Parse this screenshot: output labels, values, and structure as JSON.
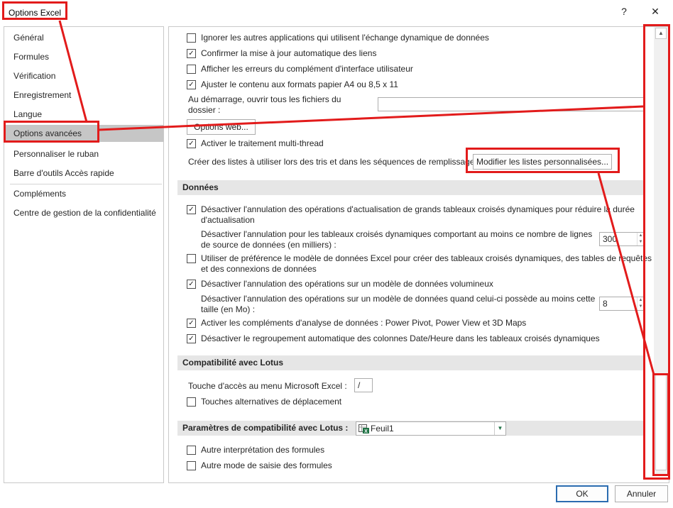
{
  "window": {
    "title": "Options Excel",
    "help_glyph": "?",
    "close_glyph": "✕"
  },
  "sidebar": {
    "items": [
      {
        "label": "Général"
      },
      {
        "label": "Formules"
      },
      {
        "label": "Vérification"
      },
      {
        "label": "Enregistrement"
      },
      {
        "label": "Langue"
      },
      {
        "label": "Options avancées",
        "selected": true
      },
      {
        "label": "Personnaliser le ruban"
      },
      {
        "label": "Barre d'outils Accès rapide"
      },
      {
        "label": "Compléments"
      },
      {
        "label": "Centre de gestion de la confidentialité"
      }
    ]
  },
  "general": {
    "opt_dde": {
      "label": "Ignorer les autres applications qui utilisent l'échange dynamique de données",
      "checked": false
    },
    "opt_links": {
      "label": "Confirmer la mise à jour automatique des liens",
      "checked": true
    },
    "opt_addin_errors": {
      "label": "Afficher les erreurs du complément d'interface utilisateur",
      "checked": false
    },
    "opt_paper": {
      "label": "Ajuster le contenu aux formats papier A4 ou 8,5 x 11",
      "checked": true
    },
    "startup_label_1": "Au démarrage, ouvrir tous les fichiers du",
    "startup_label_2": "dossier :",
    "startup_value": "",
    "web_options_button": "Options web...",
    "opt_multithread": {
      "label": "Activer le traitement multi-thread",
      "checked": true
    },
    "custom_lists_label": "Créer des listes à utiliser lors des tris et dans les séquences de remplissage :",
    "custom_lists_button": "Modifier les listes personnalisées..."
  },
  "data": {
    "section_title": "Données",
    "opt_pivot_undo": {
      "label_1": "Désactiver l'annulation des opérations d'actualisation de grands tableaux croisés dynamiques pour réduire la durée",
      "label_2": "d'actualisation",
      "checked": true
    },
    "pivot_rows_label_1": "Désactiver l'annulation pour les tableaux croisés dynamiques comportant au moins ce nombre de lignes",
    "pivot_rows_label_2": "de source de données (en milliers) :",
    "pivot_rows_value": "300",
    "opt_data_model": {
      "label_1": "Utiliser de préférence le modèle de données Excel pour créer des tableaux croisés dynamiques, des tables de requêtes",
      "label_2": "et des connexions de données",
      "checked": false
    },
    "opt_large_model": {
      "label": "Désactiver l'annulation des opérations sur un modèle de données volumineux",
      "checked": true
    },
    "model_size_label_1": "Désactiver l'annulation des opérations sur un modèle de données quand celui-ci possède au moins cette",
    "model_size_label_2": "taille (en Mo) :",
    "model_size_value": "8",
    "opt_analysis_addins": {
      "label": "Activer les compléments d'analyse de données : Power Pivot, Power View et 3D Maps",
      "checked": true
    },
    "opt_date_grouping": {
      "label": "Désactiver le regroupement automatique des colonnes Date/Heure dans les tableaux croisés dynamiques",
      "checked": true
    }
  },
  "lotus": {
    "section_title": "Compatibilité avec Lotus",
    "menu_key_label": "Touche d'accès au menu  Microsoft Excel :",
    "menu_key_value": "/",
    "opt_nav_keys": {
      "label": "Touches alternatives de déplacement",
      "checked": false
    }
  },
  "lotus_settings": {
    "section_title": "Paramètres de compatibilité avec Lotus :",
    "sheet_value": "Feuil1",
    "opt_formula_eval": {
      "label": "Autre interprétation des formules",
      "checked": false
    },
    "opt_formula_entry": {
      "label": "Autre mode de saisie des formules",
      "checked": false
    }
  },
  "footer": {
    "ok": "OK",
    "cancel": "Annuler"
  },
  "colors": {
    "highlight": "#e21b1b",
    "selected_nav": "#c6c6c6",
    "section_bg": "#e6e6e6",
    "excel_green": "#217346"
  }
}
